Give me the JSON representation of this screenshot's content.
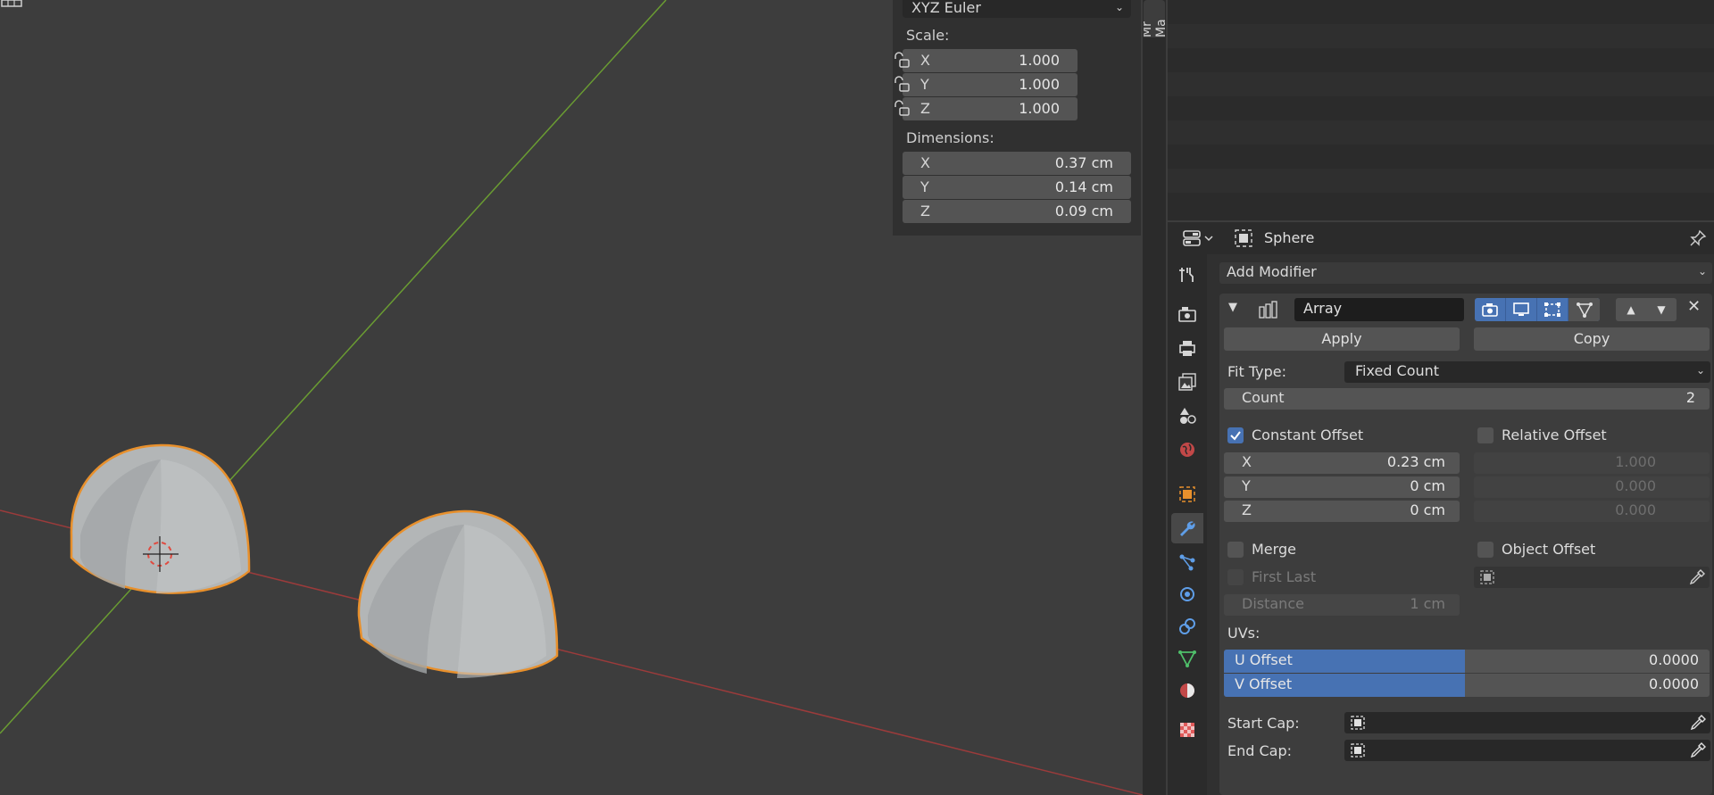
{
  "npanel": {
    "rotation_mode": "XYZ Euler",
    "scale_title": "Scale:",
    "scale": [
      {
        "axis": "X",
        "value": "1.000"
      },
      {
        "axis": "Y",
        "value": "1.000"
      },
      {
        "axis": "Z",
        "value": "1.000"
      }
    ],
    "dimensions_title": "Dimensions:",
    "dimensions": [
      {
        "axis": "X",
        "value": "0.37 cm"
      },
      {
        "axis": "Y",
        "value": "0.14 cm"
      },
      {
        "axis": "Z",
        "value": "0.09 cm"
      }
    ]
  },
  "side_tab": "Mr Ma",
  "properties": {
    "object_name": "Sphere",
    "add_modifier": "Add Modifier",
    "modifier": {
      "name": "Array",
      "apply": "Apply",
      "copy": "Copy",
      "fit_type_label": "Fit Type:",
      "fit_type": "Fixed Count",
      "count_label": "Count",
      "count": "2",
      "constant_offset": {
        "label": "Constant Offset",
        "checked": true
      },
      "relative_offset": {
        "label": "Relative Offset",
        "checked": false
      },
      "constant": [
        {
          "axis": "X",
          "value": "0.23 cm"
        },
        {
          "axis": "Y",
          "value": "0 cm"
        },
        {
          "axis": "Z",
          "value": "0 cm"
        }
      ],
      "relative": [
        "1.000",
        "0.000",
        "0.000"
      ],
      "merge": {
        "label": "Merge",
        "checked": false
      },
      "first_last": {
        "label": "First Last",
        "checked": false
      },
      "object_offset": {
        "label": "Object Offset",
        "checked": false
      },
      "distance_label": "Distance",
      "distance": "1 cm",
      "uvs_title": "UVs:",
      "u_offset_label": "U Offset",
      "u_offset": "0.0000",
      "v_offset_label": "V Offset",
      "v_offset": "0.0000",
      "start_cap_label": "Start Cap:",
      "end_cap_label": "End Cap:"
    }
  },
  "colors": {
    "accent": "#4772b3",
    "selection_outline": "#e8902c",
    "x_axis": "#9b3b3b",
    "y_axis": "#6a9c32"
  }
}
